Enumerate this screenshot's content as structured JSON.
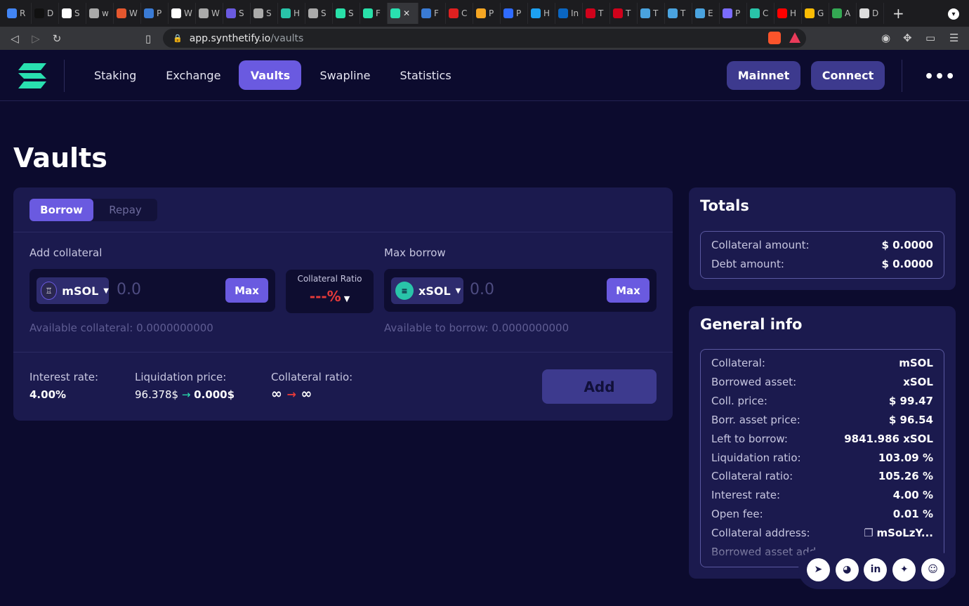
{
  "browser": {
    "tabs": [
      {
        "label": "R",
        "color": "#4285f4"
      },
      {
        "label": "D",
        "color": "#111111"
      },
      {
        "label": "S",
        "color": "#ffffff"
      },
      {
        "label": "w",
        "color": "#aaaaaa"
      },
      {
        "label": "W",
        "color": "#e4572e"
      },
      {
        "label": "P",
        "color": "#3a7bd5"
      },
      {
        "label": "W",
        "color": "#ffffff"
      },
      {
        "label": "W",
        "color": "#aaaaaa"
      },
      {
        "label": "S",
        "color": "#6a5ae0"
      },
      {
        "label": "S",
        "color": "#aaaaaa"
      },
      {
        "label": "H",
        "color": "#29c4a9"
      },
      {
        "label": "S",
        "color": "#aaaaaa"
      },
      {
        "label": "S",
        "color": "#29e0a9"
      },
      {
        "label": "F",
        "color": "#29e0a9"
      }
    ],
    "active_tab_icon": "synthetify-icon",
    "tabs_after": [
      {
        "label": "F",
        "color": "#3a7bd5"
      },
      {
        "label": "C",
        "color": "#e02020"
      },
      {
        "label": "P",
        "color": "#f5a623"
      },
      {
        "label": "P",
        "color": "#2f6bff"
      },
      {
        "label": "H",
        "color": "#1da1f2"
      },
      {
        "label": "In",
        "color": "#0a66c2"
      },
      {
        "label": "T",
        "color": "#d0021b"
      },
      {
        "label": "T",
        "color": "#d0021b"
      },
      {
        "label": "T",
        "color": "#4aa3df"
      },
      {
        "label": "T",
        "color": "#4aa3df"
      },
      {
        "label": "E",
        "color": "#4aa3df"
      },
      {
        "label": "P",
        "color": "#7b6cff"
      },
      {
        "label": "C",
        "color": "#29c4a9"
      },
      {
        "label": "H",
        "color": "#ff0000"
      },
      {
        "label": "G",
        "color": "#fbbc04"
      },
      {
        "label": "A",
        "color": "#34a853"
      },
      {
        "label": "D",
        "color": "#dddddd"
      }
    ],
    "new_tab": "+",
    "url_host": "app.synthetify.io",
    "url_path": "/vaults",
    "brave_badge": "1"
  },
  "header": {
    "nav": [
      "Staking",
      "Exchange",
      "Vaults",
      "Swapline",
      "Statistics"
    ],
    "active_nav": "Vaults",
    "network_button": "Mainnet",
    "connect_button": "Connect",
    "more": "•••"
  },
  "page": {
    "title": "Vaults"
  },
  "vault": {
    "tabs": {
      "borrow": "Borrow",
      "repay": "Repay"
    },
    "add_collateral_label": "Add collateral",
    "max_borrow_label": "Max borrow",
    "collateral_token": "mSOL",
    "collateral_amount_placeholder": "0.0",
    "borrow_token": "xSOL",
    "borrow_amount_placeholder": "0.0",
    "max_label": "Max",
    "collateral_ratio_label": "Collateral Ratio",
    "collateral_ratio_value": "---%",
    "available_collateral": "Available collateral: 0.0000000000",
    "available_to_borrow": "Available to borrow: 0.0000000000",
    "interest_rate_label": "Interest rate:",
    "interest_rate_value": "4.00%",
    "liquidation_price_label": "Liquidation price:",
    "liquidation_price_from": "96.378$",
    "liquidation_price_to": "0.000$",
    "collateral_ratio_stat_label": "Collateral ratio:",
    "collateral_ratio_from": "∞",
    "collateral_ratio_to": "∞",
    "arrow": "→",
    "add_button": "Add"
  },
  "totals": {
    "title": "Totals",
    "rows": [
      {
        "k": "Collateral amount:",
        "v": "$ 0.0000"
      },
      {
        "k": "Debt amount:",
        "v": "$ 0.0000"
      }
    ]
  },
  "general": {
    "title": "General info",
    "rows": [
      {
        "k": "Collateral:",
        "v": "mSOL"
      },
      {
        "k": "Borrowed asset:",
        "v": "xSOL"
      },
      {
        "k": "Coll. price:",
        "v": "$ 99.47"
      },
      {
        "k": "Borr. asset price:",
        "v": "$ 96.54"
      },
      {
        "k": "Left to borrow:",
        "v": "9841.986 xSOL"
      },
      {
        "k": "Liquidation ratio:",
        "v": "103.09 %"
      },
      {
        "k": "Collateral ratio:",
        "v": "105.26 %"
      },
      {
        "k": "Interest rate:",
        "v": "4.00 %"
      },
      {
        "k": "Open fee:",
        "v": "0.01 %"
      },
      {
        "k": "Collateral address:",
        "v": "mSoLzY..."
      },
      {
        "k": "Borrowed asset add",
        "v": ""
      }
    ]
  },
  "socials": [
    "telegram-icon",
    "github-icon",
    "linkedin-icon",
    "twitter-icon",
    "discord-icon"
  ],
  "colors": {
    "accent": "#6a5ae0",
    "background": "#0c0b2e",
    "card": "#1b1a4e",
    "brand": "#29e0b0",
    "danger": "#e53a3a"
  }
}
